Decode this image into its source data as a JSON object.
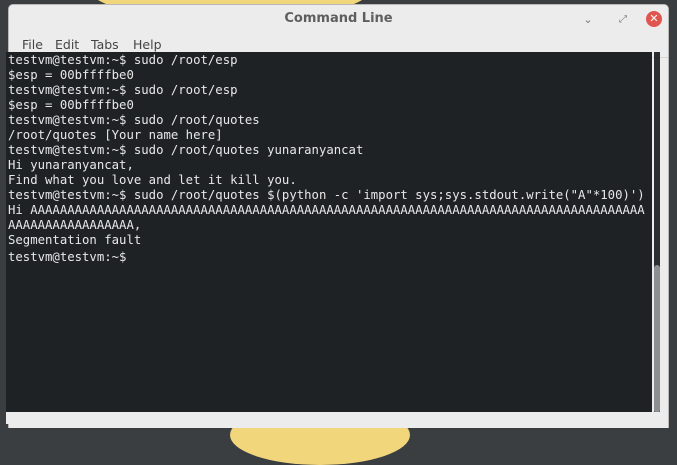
{
  "window": {
    "title": "Command Line"
  },
  "controls": {
    "minimize": "⌄",
    "maximize": "⤢",
    "close": "✕"
  },
  "menu": {
    "file": "File",
    "edit": "Edit",
    "tabs": "Tabs",
    "help": "Help"
  },
  "terminal": {
    "lines": [
      "testvm@testvm:~$ sudo /root/esp",
      "$esp = 00bffffbe0",
      "testvm@testvm:~$ sudo /root/esp",
      "$esp = 00bffffbe0",
      "testvm@testvm:~$ sudo /root/quotes",
      "/root/quotes [Your name here]",
      "testvm@testvm:~$ sudo /root/quotes yunaranyancat",
      "Hi yunaranyancat,",
      "Find what you love and let it kill you.",
      "testvm@testvm:~$ sudo /root/quotes $(python -c 'import sys;sys.stdout.write(\"A\"*100)')",
      "Hi AAAAAAAAAAAAAAAAAAAAAAAAAAAAAAAAAAAAAAAAAAAAAAAAAAAAAAAAAAAAAAAAAAAAAAAAAAAAAAAAAAAAAAAAAAAAAAAAAAAA,",
      "Segmentation fault",
      "testvm@testvm:~$ "
    ]
  }
}
